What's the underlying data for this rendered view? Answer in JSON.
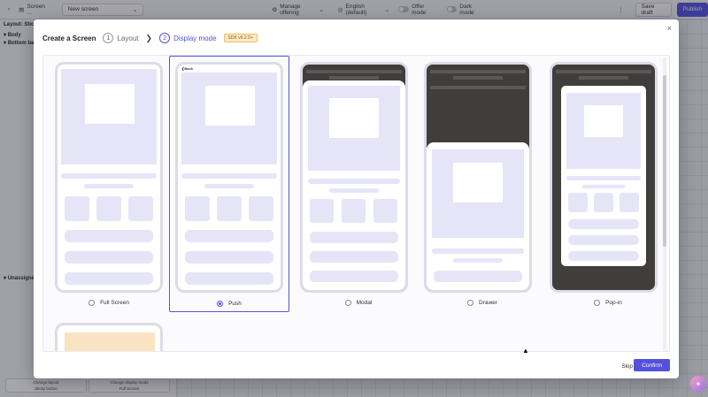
{
  "topbar": {
    "screen_label": "Screen ...",
    "screen_select": "New screen",
    "manage_offering": "Manage offering",
    "language": "English (default)",
    "offer_mode": "Offer mode",
    "dark_mode": "Dark mode",
    "more": "⋮",
    "save_draft": "Save draft",
    "publish": "Publish"
  },
  "left_panel": {
    "layout_label": "Layout: Stick",
    "body": "Body",
    "bottom_bar": "Bottom ba",
    "unassigned": "Unassigne"
  },
  "bottom_cards": [
    {
      "title": "Change layout",
      "value": "Sticky button"
    },
    {
      "title": "Change display mode",
      "value": "Full Screen"
    }
  ],
  "modal": {
    "title": "Create a Screen",
    "steps": [
      {
        "num": "1",
        "label": "Layout"
      },
      {
        "num": "2",
        "label": "Display mode"
      }
    ],
    "badge": "SDK v6.2.0+",
    "close": "×",
    "options": [
      {
        "label": "Full Screen",
        "selected": false
      },
      {
        "label": "Push",
        "selected": true,
        "back_label": "❮Back"
      },
      {
        "label": "Modal",
        "selected": false
      },
      {
        "label": "Drawer",
        "selected": false
      },
      {
        "label": "Pop-in",
        "selected": false
      }
    ],
    "skip": "Skip",
    "confirm": "Confirm"
  },
  "colors": {
    "accent": "#5252dd",
    "wireframe": "#e6e5f8",
    "badge_bg": "#fde9c7",
    "dark_overlay": "#3f3e3d"
  }
}
